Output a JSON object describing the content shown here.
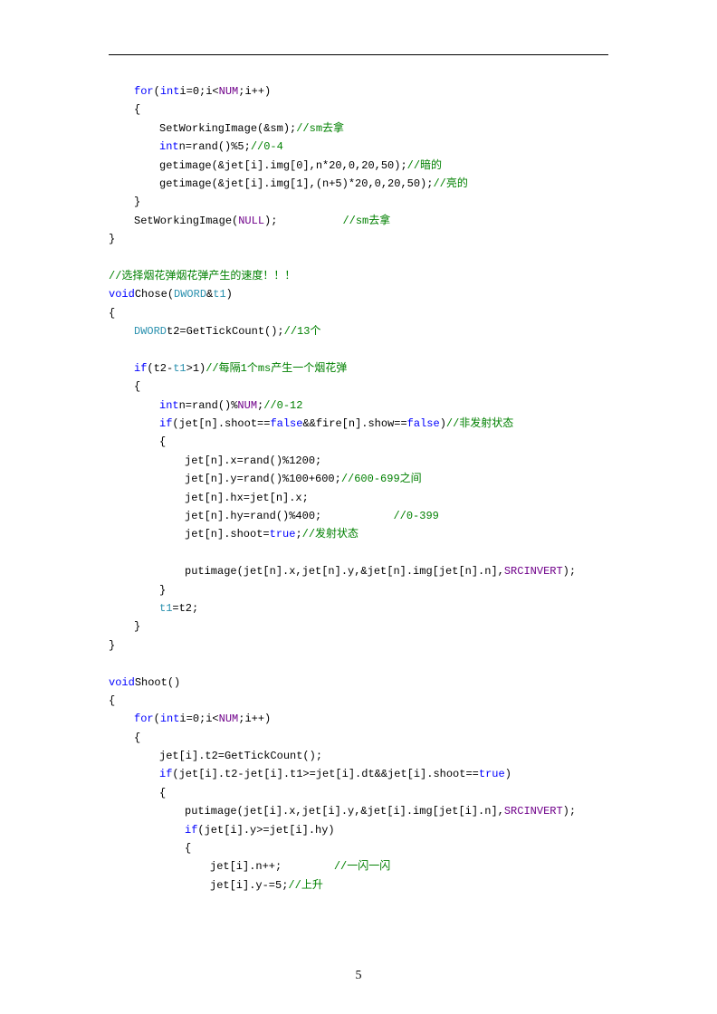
{
  "page_number": "5",
  "lines": [
    {
      "indent": 1,
      "tokens": [
        {
          "t": "for",
          "c": "kw"
        },
        {
          "t": "("
        },
        {
          "t": "int",
          "c": "kw"
        },
        {
          "t": "i=0;i<"
        },
        {
          "t": "NUM",
          "c": "const"
        },
        {
          "t": ";i++)"
        }
      ]
    },
    {
      "indent": 1,
      "tokens": [
        {
          "t": "{"
        }
      ]
    },
    {
      "indent": 2,
      "tokens": [
        {
          "t": "SetWorkingImage(&sm);"
        },
        {
          "t": "//sm去拿",
          "c": "cm"
        }
      ]
    },
    {
      "indent": 2,
      "tokens": [
        {
          "t": "int",
          "c": "kw"
        },
        {
          "t": "n=rand()%5;"
        },
        {
          "t": "//0-4",
          "c": "cm"
        }
      ]
    },
    {
      "indent": 2,
      "tokens": [
        {
          "t": "getimage(&jet[i].img[0],n*20,0,20,50);"
        },
        {
          "t": "//暗的",
          "c": "cm"
        }
      ]
    },
    {
      "indent": 2,
      "tokens": [
        {
          "t": "getimage(&jet[i].img[1],(n+5)*20,0,20,50);"
        },
        {
          "t": "//亮的",
          "c": "cm"
        }
      ]
    },
    {
      "indent": 1,
      "tokens": [
        {
          "t": "}"
        }
      ]
    },
    {
      "indent": 1,
      "tokens": [
        {
          "t": "SetWorkingImage("
        },
        {
          "t": "NULL",
          "c": "const"
        },
        {
          "t": ");          "
        },
        {
          "t": "//sm去拿",
          "c": "cm"
        }
      ]
    },
    {
      "indent": 0,
      "tokens": [
        {
          "t": "}"
        }
      ]
    },
    {
      "indent": 0,
      "tokens": [
        {
          "t": ""
        }
      ]
    },
    {
      "indent": 0,
      "tokens": [
        {
          "t": "//选择烟花弹烟花弹产生的速度！！！",
          "c": "cm"
        }
      ]
    },
    {
      "indent": 0,
      "tokens": [
        {
          "t": "void",
          "c": "kw"
        },
        {
          "t": "Chose("
        },
        {
          "t": "DWORD",
          "c": "num"
        },
        {
          "t": "&"
        },
        {
          "t": "t1",
          "c": "num"
        },
        {
          "t": ")"
        }
      ]
    },
    {
      "indent": 0,
      "tokens": [
        {
          "t": "{"
        }
      ]
    },
    {
      "indent": 1,
      "tokens": [
        {
          "t": "DWORD",
          "c": "num"
        },
        {
          "t": "t2=GetTickCount();"
        },
        {
          "t": "//13个",
          "c": "cm"
        }
      ]
    },
    {
      "indent": 0,
      "tokens": [
        {
          "t": ""
        }
      ]
    },
    {
      "indent": 1,
      "tokens": [
        {
          "t": "if",
          "c": "kw"
        },
        {
          "t": "(t2-"
        },
        {
          "t": "t1",
          "c": "num"
        },
        {
          "t": ">1)"
        },
        {
          "t": "//每隔1个ms产生一个烟花弹",
          "c": "cm"
        }
      ]
    },
    {
      "indent": 1,
      "tokens": [
        {
          "t": "{"
        }
      ]
    },
    {
      "indent": 2,
      "tokens": [
        {
          "t": "int",
          "c": "kw"
        },
        {
          "t": "n=rand()%"
        },
        {
          "t": "NUM",
          "c": "const"
        },
        {
          "t": ";"
        },
        {
          "t": "//0-12",
          "c": "cm"
        }
      ]
    },
    {
      "indent": 2,
      "tokens": [
        {
          "t": "if",
          "c": "kw"
        },
        {
          "t": "(jet[n].shoot=="
        },
        {
          "t": "false",
          "c": "kw"
        },
        {
          "t": "&&fire[n].show=="
        },
        {
          "t": "false",
          "c": "kw"
        },
        {
          "t": ")"
        },
        {
          "t": "//非发射状态",
          "c": "cm"
        }
      ]
    },
    {
      "indent": 2,
      "tokens": [
        {
          "t": "{"
        }
      ]
    },
    {
      "indent": 3,
      "tokens": [
        {
          "t": "jet[n].x=rand()%1200;"
        }
      ]
    },
    {
      "indent": 3,
      "tokens": [
        {
          "t": "jet[n].y=rand()%100+600;"
        },
        {
          "t": "//600-699之间",
          "c": "cm"
        }
      ]
    },
    {
      "indent": 3,
      "tokens": [
        {
          "t": "jet[n].hx=jet[n].x;"
        }
      ]
    },
    {
      "indent": 3,
      "tokens": [
        {
          "t": "jet[n].hy=rand()%400;           "
        },
        {
          "t": "//0-399",
          "c": "cm"
        }
      ]
    },
    {
      "indent": 3,
      "tokens": [
        {
          "t": "jet[n].shoot="
        },
        {
          "t": "true",
          "c": "kw"
        },
        {
          "t": ";"
        },
        {
          "t": "//发射状态",
          "c": "cm"
        }
      ]
    },
    {
      "indent": 0,
      "tokens": [
        {
          "t": ""
        }
      ]
    },
    {
      "indent": 3,
      "tokens": [
        {
          "t": "putimage(jet[n].x,jet[n].y,&jet[n].img[jet[n].n],"
        },
        {
          "t": "SRCINVERT",
          "c": "const"
        },
        {
          "t": ");"
        }
      ]
    },
    {
      "indent": 2,
      "tokens": [
        {
          "t": "}"
        }
      ]
    },
    {
      "indent": 2,
      "tokens": [
        {
          "t": "t1",
          "c": "num"
        },
        {
          "t": "=t2;"
        }
      ]
    },
    {
      "indent": 1,
      "tokens": [
        {
          "t": "}"
        }
      ]
    },
    {
      "indent": 0,
      "tokens": [
        {
          "t": "}"
        }
      ]
    },
    {
      "indent": 0,
      "tokens": [
        {
          "t": ""
        }
      ]
    },
    {
      "indent": 0,
      "tokens": [
        {
          "t": "void",
          "c": "kw"
        },
        {
          "t": "Shoot()"
        }
      ]
    },
    {
      "indent": 0,
      "tokens": [
        {
          "t": "{"
        }
      ]
    },
    {
      "indent": 1,
      "tokens": [
        {
          "t": "for",
          "c": "kw"
        },
        {
          "t": "("
        },
        {
          "t": "int",
          "c": "kw"
        },
        {
          "t": "i=0;i<"
        },
        {
          "t": "NUM",
          "c": "const"
        },
        {
          "t": ";i++)"
        }
      ]
    },
    {
      "indent": 1,
      "tokens": [
        {
          "t": "{"
        }
      ]
    },
    {
      "indent": 2,
      "tokens": [
        {
          "t": "jet[i].t2=GetTickCount();"
        }
      ]
    },
    {
      "indent": 2,
      "tokens": [
        {
          "t": "if",
          "c": "kw"
        },
        {
          "t": "(jet[i].t2-jet[i].t1>=jet[i].dt&&jet[i].shoot=="
        },
        {
          "t": "true",
          "c": "kw"
        },
        {
          "t": ")"
        }
      ]
    },
    {
      "indent": 2,
      "tokens": [
        {
          "t": "{"
        }
      ]
    },
    {
      "indent": 3,
      "tokens": [
        {
          "t": "putimage(jet[i].x,jet[i].y,&jet[i].img[jet[i].n],"
        },
        {
          "t": "SRCINVERT",
          "c": "const"
        },
        {
          "t": ");"
        }
      ]
    },
    {
      "indent": 3,
      "tokens": [
        {
          "t": "if",
          "c": "kw"
        },
        {
          "t": "(jet[i].y>=jet[i].hy)"
        }
      ]
    },
    {
      "indent": 3,
      "tokens": [
        {
          "t": "{"
        }
      ]
    },
    {
      "indent": 4,
      "tokens": [
        {
          "t": "jet[i].n++;        "
        },
        {
          "t": "//一闪一闪",
          "c": "cm"
        }
      ]
    },
    {
      "indent": 4,
      "tokens": [
        {
          "t": "jet[i].y-=5;"
        },
        {
          "t": "//上升",
          "c": "cm"
        }
      ]
    }
  ]
}
